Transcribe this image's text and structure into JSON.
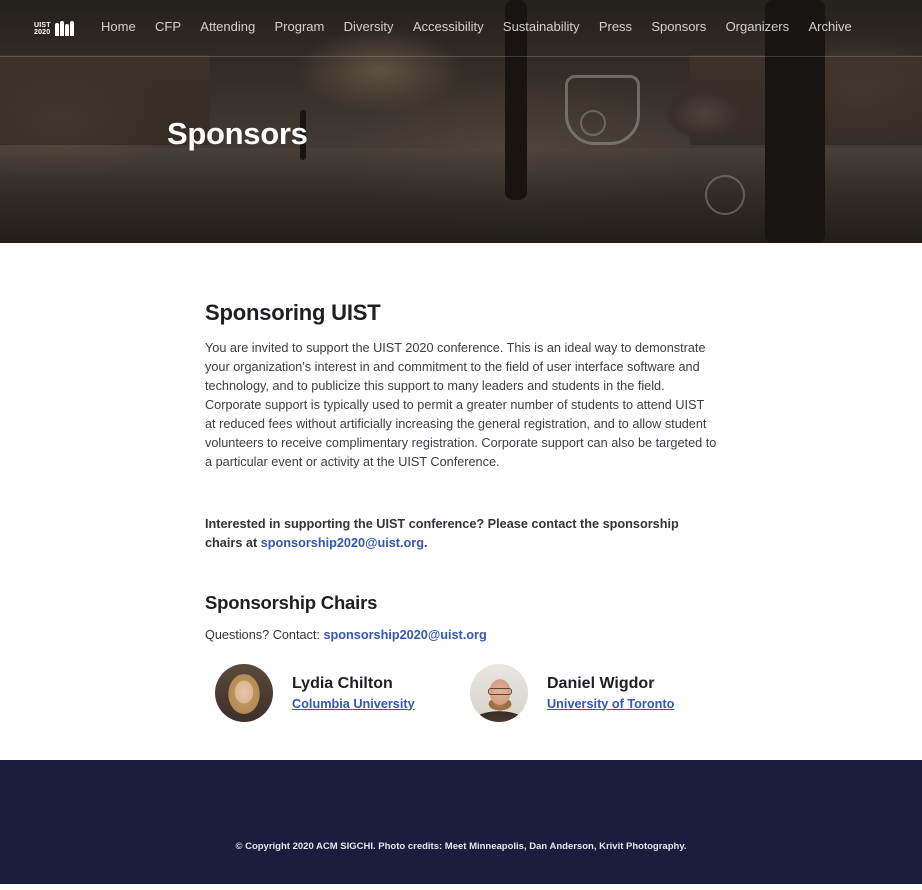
{
  "nav": {
    "logo": {
      "line1": "UIST",
      "line2": "2020"
    },
    "links": [
      "Home",
      "CFP",
      "Attending",
      "Program",
      "Diversity",
      "Accessibility",
      "Sustainability",
      "Press",
      "Sponsors",
      "Organizers",
      "Archive"
    ]
  },
  "hero": {
    "title": "Sponsors"
  },
  "main": {
    "heading": "Sponsoring UIST",
    "intro": "You are invited to support the UIST 2020 conference. This is an ideal way to demonstrate your organization's interest in and commitment to the field of user interface software and technology, and to publicize this support to many leaders and students in the field. Corporate support is typically used to permit a greater number of students to attend UIST at reduced fees without artificially increasing the general registration, and to allow student volunteers to receive complimentary registration. Corporate support can also be targeted to a particular event or activity at the UIST Conference.",
    "contact_prefix": "Interested in supporting the UIST conference? Please contact the sponsorship chairs at ",
    "contact_email": "sponsorship2020@uist.org",
    "contact_suffix": ".",
    "chairs_heading": "Sponsorship Chairs",
    "questions_label": "Questions? Contact: ",
    "questions_email": "sponsorship2020@uist.org",
    "chairs": [
      {
        "name": "Lydia Chilton",
        "affiliation": "Columbia University"
      },
      {
        "name": "Daniel Wigdor",
        "affiliation": "University of Toronto"
      }
    ]
  },
  "footer": {
    "text": "© Copyright 2020 ACM SIGCHI. Photo credits: Meet Minneapolis, Dan Anderson, Krivit Photography."
  },
  "colors": {
    "link": "#3555b8",
    "footer_bg": "#1a1d3d",
    "heading": "#1f1f23"
  }
}
